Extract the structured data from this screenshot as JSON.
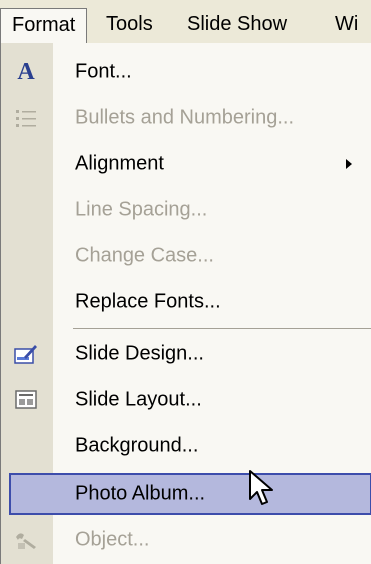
{
  "menubar": {
    "items": [
      {
        "label": "Format",
        "active": true
      },
      {
        "label": "Tools"
      },
      {
        "label": "Slide Show"
      },
      {
        "label": "Wi"
      }
    ]
  },
  "format_menu": {
    "items": [
      {
        "label": "Font...",
        "icon": "font-icon",
        "enabled": true
      },
      {
        "label": "Bullets and Numbering...",
        "icon": "bullets-icon",
        "enabled": false
      },
      {
        "label": "Alignment",
        "submenu": true,
        "enabled": true
      },
      {
        "label": "Line Spacing...",
        "enabled": false
      },
      {
        "label": "Change Case...",
        "enabled": false
      },
      {
        "label": "Replace Fonts...",
        "enabled": true
      },
      {
        "label": "Slide Design...",
        "icon": "slide-design-icon",
        "enabled": true
      },
      {
        "label": "Slide Layout...",
        "icon": "slide-layout-icon",
        "enabled": true
      },
      {
        "label": "Background...",
        "enabled": true
      },
      {
        "label": "Photo Album...",
        "enabled": true,
        "highlighted": true
      },
      {
        "label": "Object...",
        "icon": "object-icon",
        "enabled": false
      }
    ]
  },
  "colors": {
    "highlight_fill": "#b4b8dd",
    "highlight_border": "#3d4dab",
    "disabled_text": "#a5a196",
    "menu_bg": "#f9f8f3",
    "gutter_bg": "#e3e0d2"
  }
}
